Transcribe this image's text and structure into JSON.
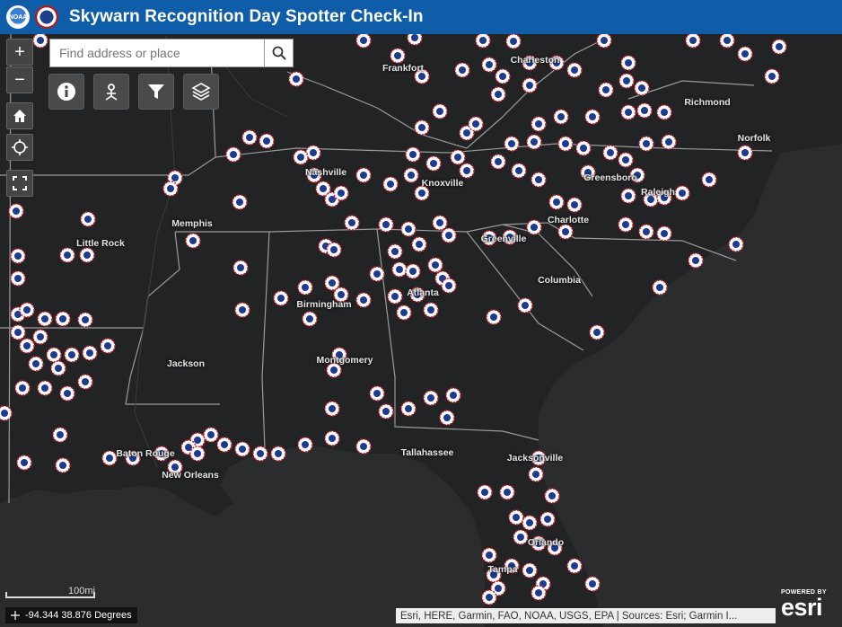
{
  "header": {
    "title": "Skywarn Recognition Day Spotter Check-In",
    "logos": [
      {
        "name": "noaa-logo",
        "text": "NOAA"
      },
      {
        "name": "nws-logo",
        "text": ""
      }
    ]
  },
  "search": {
    "placeholder": "Find address or place",
    "button_icon": "search-icon"
  },
  "zoom_controls": {
    "zoom_in": "+",
    "zoom_out": "−"
  },
  "map_controls": [
    "home-icon",
    "locate-icon",
    "fullscreen-icon"
  ],
  "toolbar": [
    {
      "name": "info-icon"
    },
    {
      "name": "measure-icon"
    },
    {
      "name": "filter-icon"
    },
    {
      "name": "layers-icon"
    }
  ],
  "cities": [
    {
      "name": "Frankfort"
    },
    {
      "name": "Charleston"
    },
    {
      "name": "Richmond"
    },
    {
      "name": "Norfolk"
    },
    {
      "name": "Nashville"
    },
    {
      "name": "Knoxville"
    },
    {
      "name": "Greensboro"
    },
    {
      "name": "Raleigh"
    },
    {
      "name": "Memphis"
    },
    {
      "name": "Charlotte"
    },
    {
      "name": "Little Rock"
    },
    {
      "name": "Greenville"
    },
    {
      "name": "Columbia"
    },
    {
      "name": "Atlanta"
    },
    {
      "name": "Birmingham"
    },
    {
      "name": "Montgomery"
    },
    {
      "name": "Jackson"
    },
    {
      "name": "Baton Rouge"
    },
    {
      "name": "New Orleans"
    },
    {
      "name": "Tallahassee"
    },
    {
      "name": "Jacksonville"
    },
    {
      "name": "Orlando"
    },
    {
      "name": "Tampa"
    }
  ],
  "scale": {
    "label": "100mi"
  },
  "coordinates": {
    "text": "-94.344 38.876 Degrees"
  },
  "attribution": {
    "text": "Esri, HERE, Garmin, FAO, NOAA, USGS, EPA | Sources: Esri; Garmin I..."
  },
  "esri": {
    "powered": "POWERED BY",
    "brand": "esri"
  },
  "colors": {
    "header": "#0f5da8",
    "land": "#222325",
    "water": "#2e3032",
    "border": "#9a9a9a",
    "marker_ring": "#cc1f2e",
    "marker_fill": "#ffffff",
    "marker_center": "#1e3a8f"
  }
}
